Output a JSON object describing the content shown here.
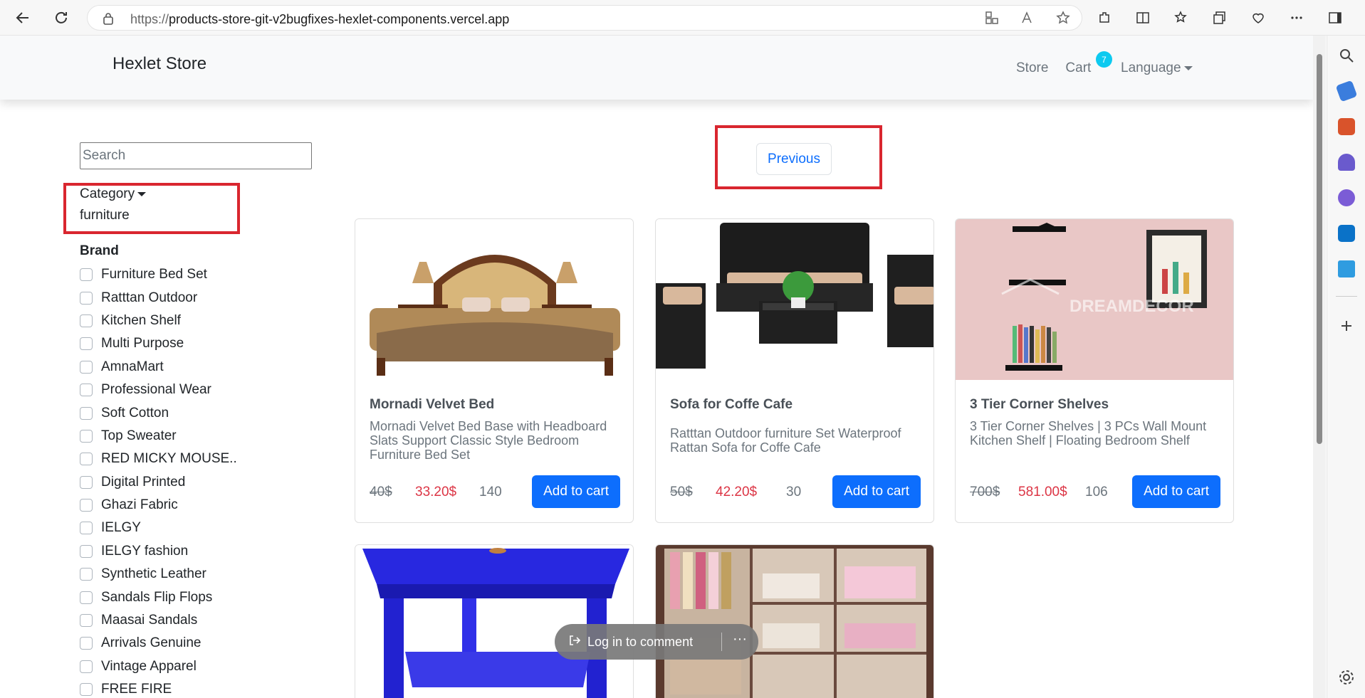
{
  "browser": {
    "url_prefix": "https://",
    "url_host": "products-store-git-v2bugfixes-hexlet-components.vercel.app"
  },
  "navbar": {
    "brand": "Hexlet Store",
    "links": [
      "Store",
      "Cart"
    ],
    "cart_count": "7",
    "language": "Language"
  },
  "filters": {
    "search_placeholder": "Search",
    "category_label": "Category",
    "category_value": "furniture",
    "brand_heading": "Brand",
    "brands": [
      "Furniture Bed Set",
      "Ratttan Outdoor",
      "Kitchen Shelf",
      "Multi Purpose",
      "AmnaMart",
      "Professional Wear",
      "Soft Cotton",
      "Top Sweater",
      "RED MICKY MOUSE..",
      "Digital Printed",
      "Ghazi Fabric",
      "IELGY",
      "IELGY fashion",
      "Synthetic Leather",
      "Sandals Flip Flops",
      "Maasai Sandals",
      "Arrivals Genuine",
      "Vintage Apparel",
      "FREE FIRE"
    ]
  },
  "pagination": {
    "previous": "Previous"
  },
  "products": [
    {
      "title": "Mornadi Velvet Bed",
      "description": "Mornadi Velvet Bed Base with Headboard Slats Support Classic Style Bedroom Furniture Bed Set",
      "old_price": "40$",
      "new_price": "33.20$",
      "stock": "140",
      "button": "Add to cart"
    },
    {
      "title": "Sofa for Coffe Cafe",
      "description": "Ratttan Outdoor furniture Set Waterproof Rattan Sofa for Coffe Cafe",
      "old_price": "50$",
      "new_price": "42.20$",
      "stock": "30",
      "button": "Add to cart"
    },
    {
      "title": "3 Tier Corner Shelves",
      "description": "3 Tier Corner Shelves | 3 PCs Wall Mount Kitchen Shelf | Floating Bedroom Shelf",
      "old_price": "700$",
      "new_price": "581.00$",
      "stock": "106",
      "button": "Add to cart"
    }
  ],
  "comment_bar": {
    "label": "Log in to comment",
    "more": "···"
  },
  "colors": {
    "primary": "#0d6efd",
    "danger": "#dc3545",
    "highlight": "#d9262f",
    "badge": "#0dcaf0"
  }
}
